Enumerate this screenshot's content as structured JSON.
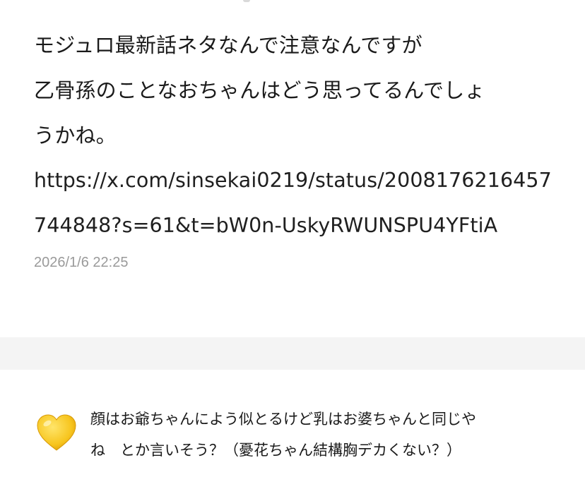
{
  "post": {
    "lines": [
      "モジュロ最新話ネタなんで注意なんですが",
      "乙骨孫のことなおちゃんはどう思ってるんでしょ",
      "うかね。"
    ],
    "url_lines": [
      "https://x.com/sinsekai0219/status/2008176216457",
      "744848?s=61&t=bW0n-UskyRWUNSPU4YFtiA"
    ],
    "timestamp": "2026/1/6 22:25"
  },
  "reply": {
    "icon": "yellow-heart-icon",
    "icon_color": "#f7c51e",
    "lines": [
      "顔はお爺ちゃんによう似とるけど乳はお婆ちゃんと同じや",
      "ね　とか言いそう？（憂花ちゃん結構胸デカくない？）"
    ]
  },
  "colors": {
    "text": "#1a1a1a",
    "timestamp": "#9a9a9a",
    "separator": "#f4f4f4"
  }
}
